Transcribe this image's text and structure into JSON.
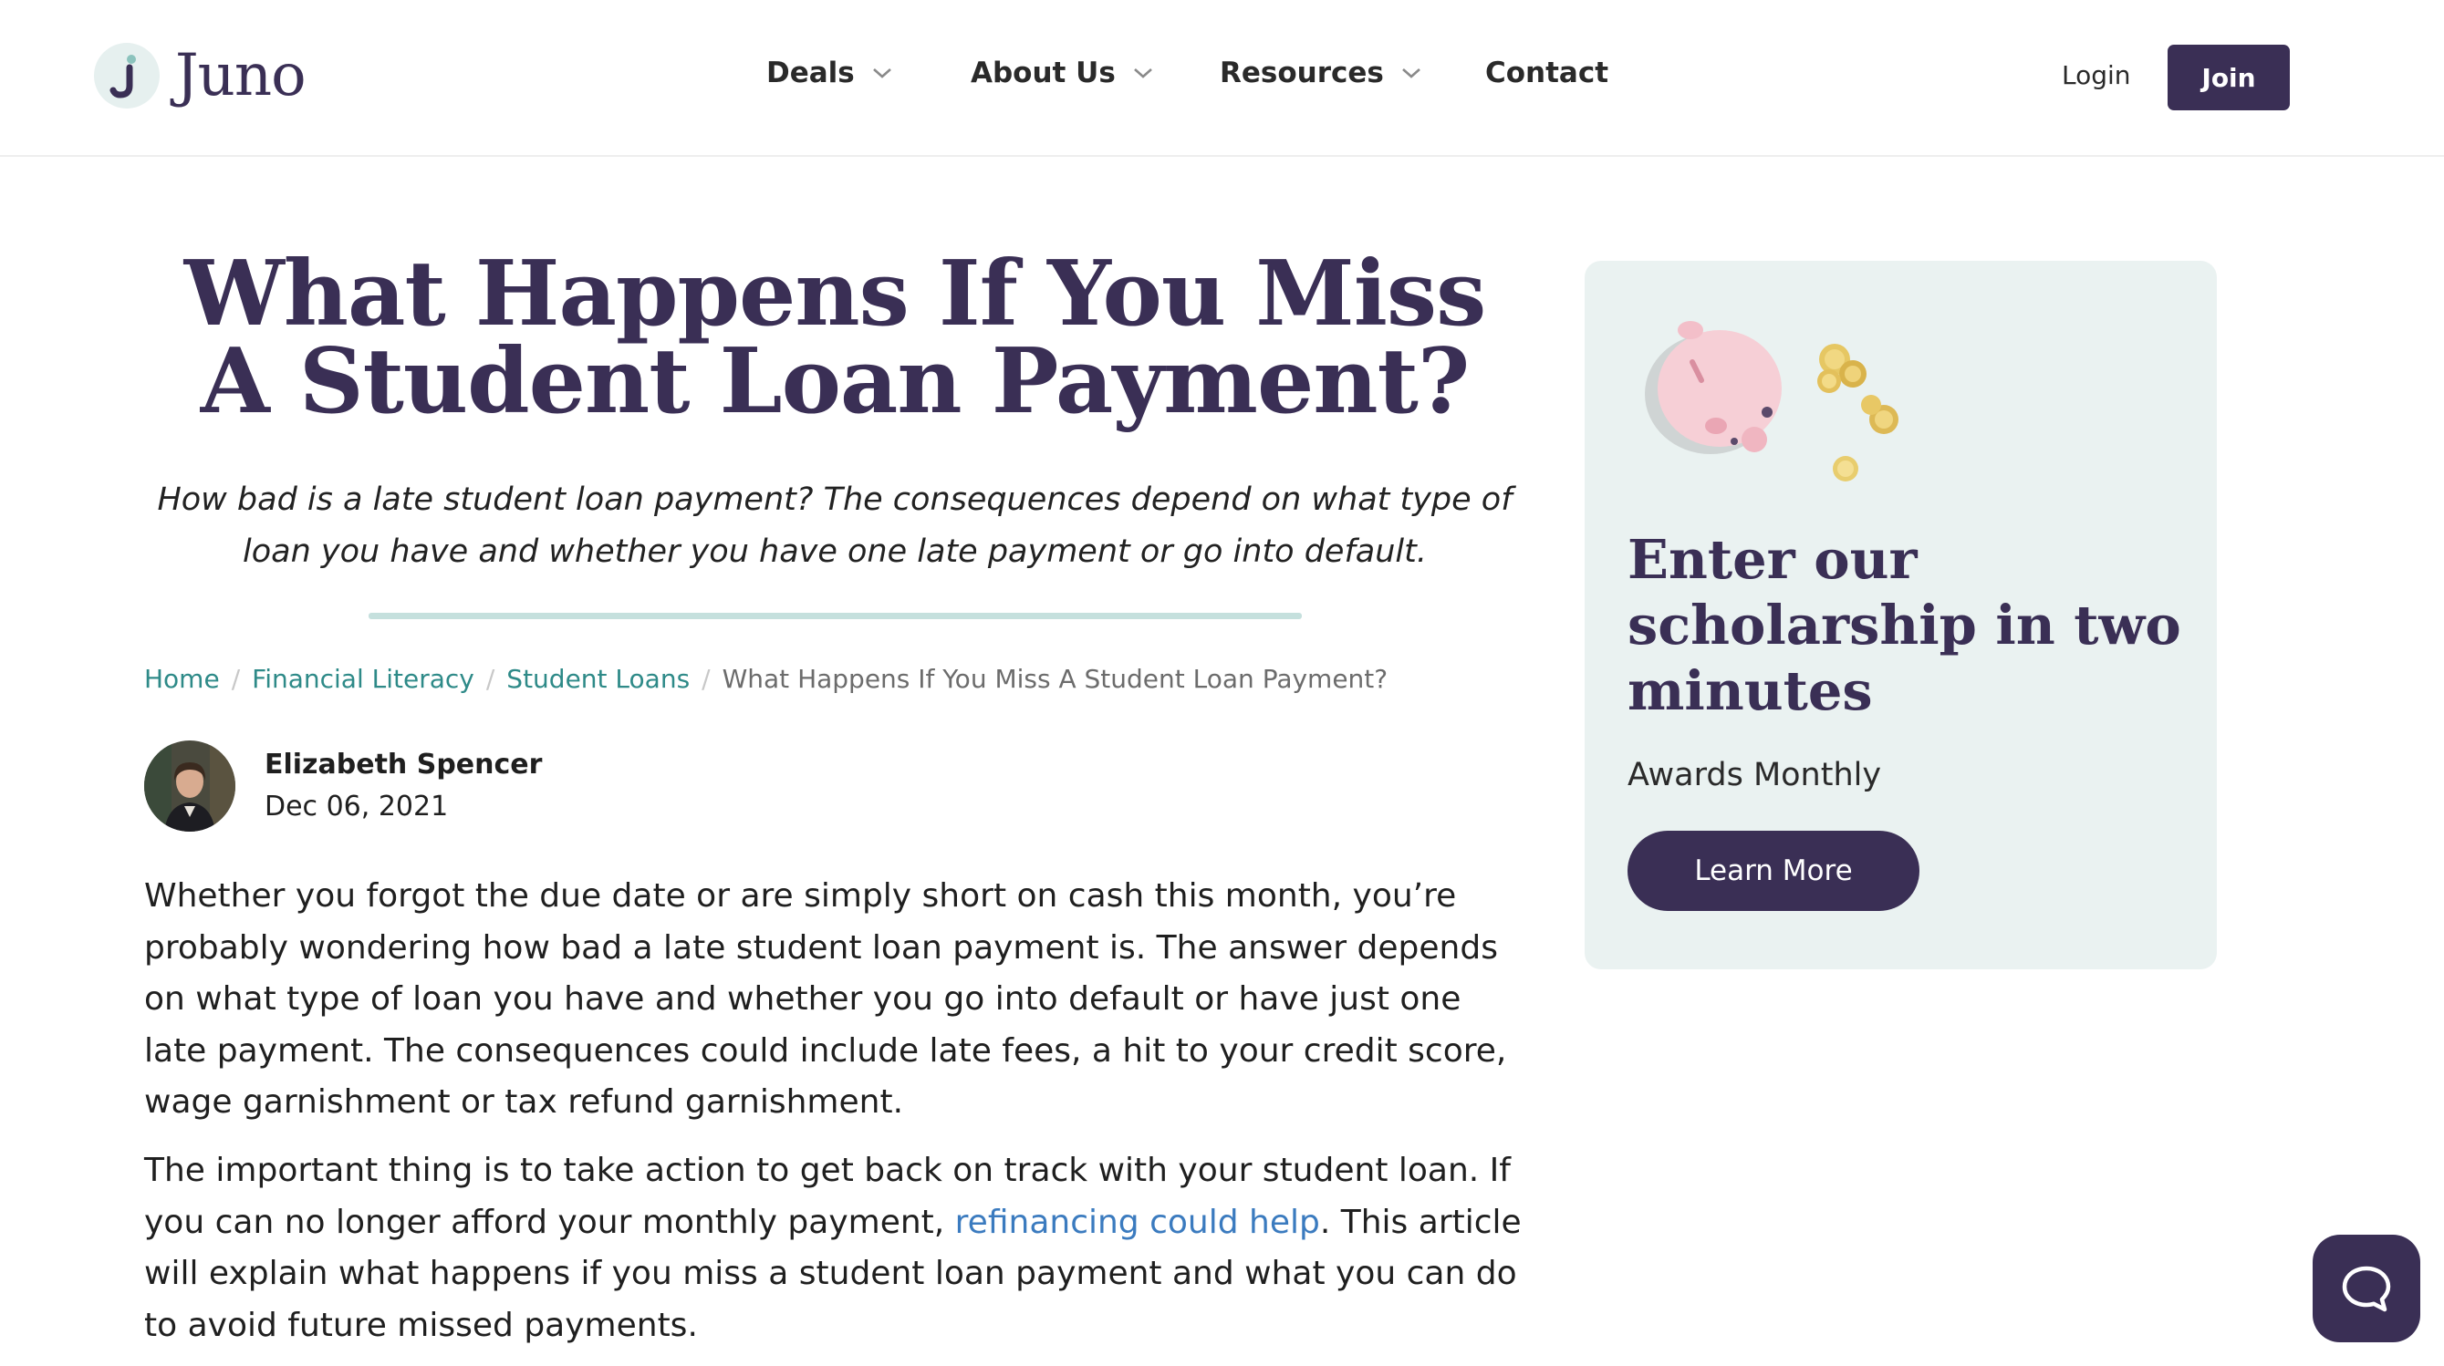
{
  "brand": {
    "name": "Juno",
    "color": "#3a2f55",
    "accent": "#2e8a88"
  },
  "nav": {
    "items": [
      {
        "label": "Deals",
        "has_dropdown": true
      },
      {
        "label": "About Us",
        "has_dropdown": true
      },
      {
        "label": "Resources",
        "has_dropdown": true
      },
      {
        "label": "Contact",
        "has_dropdown": false
      }
    ],
    "login_label": "Login",
    "join_label": "Join"
  },
  "article": {
    "title": "What Happens If You Miss A Student Loan Payment?",
    "subtitle": "How bad is a late student loan payment? The consequences depend on what type of loan you have and whether you have one late payment or go into default.",
    "breadcrumb": [
      "Home",
      "Financial Literacy",
      "Student Loans",
      "What Happens If You Miss A Student Loan Payment?"
    ],
    "author": {
      "name": "Elizabeth Spencer",
      "date": "Dec 06, 2021"
    },
    "paragraph1": "Whether you forgot the due date or are simply short on cash this month, you’re probably wondering how bad a late student loan payment is. The answer depends on what type of loan you have and whether you go into default or have just one late payment. The consequences could include late fees, a hit to your credit score, wage garnishment or tax refund garnishment.",
    "paragraph2_before": "The important thing is to take action to get back on track with your student loan. If you can no longer afford your monthly payment, ",
    "paragraph2_link": "refinancing could help",
    "paragraph2_after": ". This article will explain what happens if you miss a student loan payment and what you can do to avoid future missed payments."
  },
  "sidebar": {
    "card_title": "Enter our scholarship in two minutes",
    "card_subtitle": "Awards Monthly",
    "card_button": "Learn More",
    "card_art_icons": [
      "piggy-bank-icon",
      "coins-icon"
    ]
  },
  "chat": {
    "icon": "chat-bubble-icon"
  }
}
